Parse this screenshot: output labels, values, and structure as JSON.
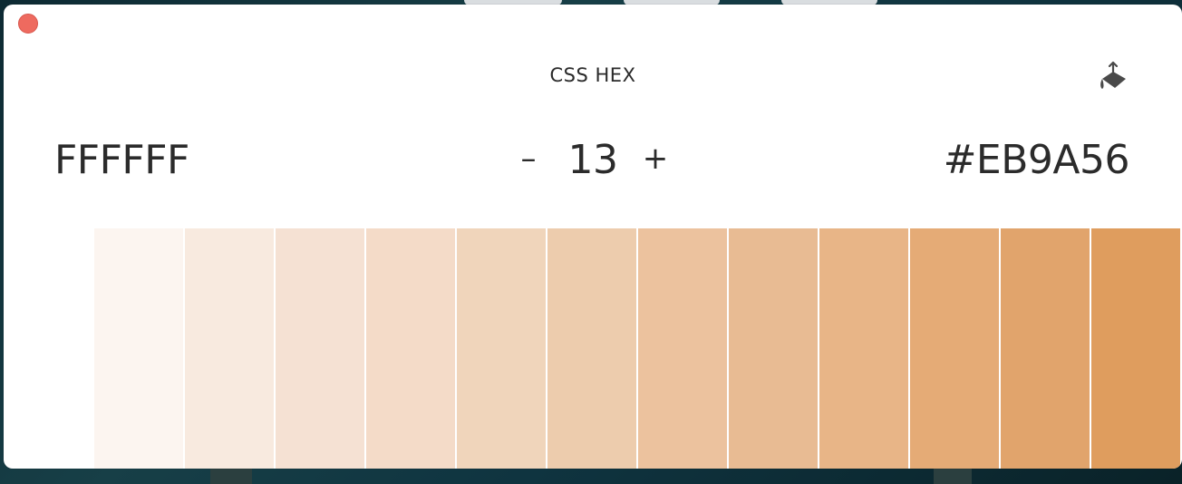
{
  "window": {
    "format_label": "CSS HEX",
    "start_color": "FFFFFF",
    "end_color": "#EB9A56",
    "count": "13",
    "decrement_label": "–",
    "increment_label": "+"
  },
  "colors": {
    "close_button": "#EE6A5F",
    "swatches": [
      "#FCF5F0",
      "#F8EADF",
      "#F5E1D3",
      "#F4DBC8",
      "#F0D5BB",
      "#EDCCAD",
      "#ECC29E",
      "#E8BB93",
      "#E8B587",
      "#E5AB76",
      "#E1A46C",
      "#DF9D5E"
    ]
  }
}
